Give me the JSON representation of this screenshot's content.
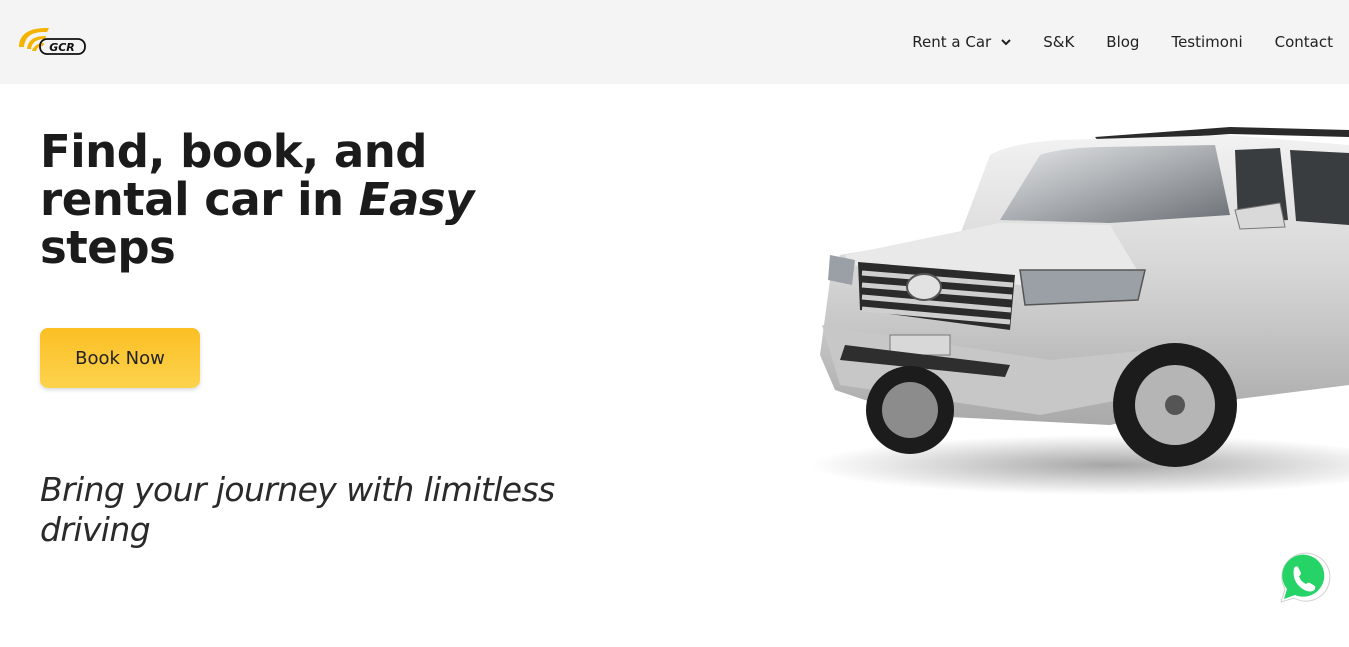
{
  "brand": {
    "logo_text": "GCR",
    "accent_color": "#f5b301"
  },
  "nav": {
    "items": [
      {
        "label": "Rent a Car",
        "has_dropdown": true
      },
      {
        "label": "S&K"
      },
      {
        "label": "Blog"
      },
      {
        "label": "Testimoni"
      },
      {
        "label": "Contact"
      }
    ]
  },
  "hero": {
    "title_line1": "Find, book, and",
    "title_line2_prefix": "rental car in ",
    "title_line2_emphasis": "Easy",
    "title_line3": "steps",
    "cta_label": "Book Now",
    "cta_color": "#fbbf24",
    "tagline": "Bring your journey with limitless driving"
  },
  "floating": {
    "whatsapp_icon": "whatsapp-icon",
    "whatsapp_color": "#25d366"
  }
}
